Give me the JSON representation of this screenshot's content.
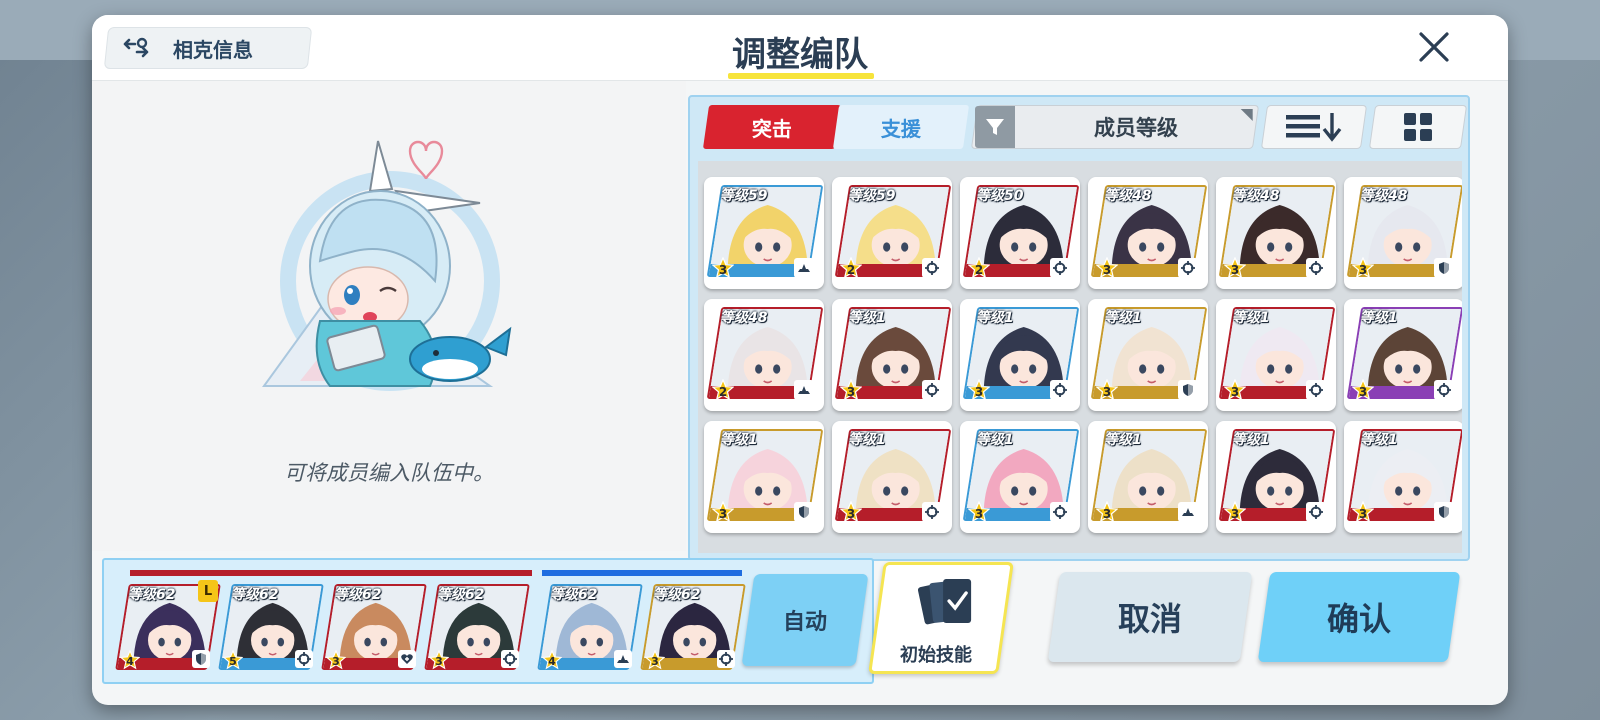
{
  "header": {
    "affinity_label": "相克信息",
    "title": "调整编队"
  },
  "empty_area": {
    "hint": "可将成员编入队伍中。"
  },
  "tabs": {
    "attack": "突击",
    "support": "支援"
  },
  "filter": {
    "label": "成员等级"
  },
  "roster": [
    {
      "level": "等级59",
      "star": "3",
      "role": "tank-icon",
      "frame": "#3a9ad6",
      "bg": "#f2d36a"
    },
    {
      "level": "等级59",
      "star": "2",
      "role": "target-icon",
      "frame": "#b51e2a",
      "bg": "#f5de8a"
    },
    {
      "level": "等级50",
      "star": "2",
      "role": "target-icon",
      "frame": "#b51e2a",
      "bg": "#2c2c3a"
    },
    {
      "level": "等级48",
      "star": "3",
      "role": "target-icon",
      "frame": "#c89b2c",
      "bg": "#3a3346"
    },
    {
      "level": "等级48",
      "star": "3",
      "role": "target-icon",
      "frame": "#c89b2c",
      "bg": "#3b2a2a"
    },
    {
      "level": "等级48",
      "star": "3",
      "role": "shield-icon",
      "frame": "#c89b2c",
      "bg": "#e6e8ef"
    },
    {
      "level": "等级48",
      "star": "2",
      "role": "tank-icon",
      "frame": "#b51e2a",
      "bg": "#e9e4e6"
    },
    {
      "level": "等级1",
      "star": "3",
      "role": "target-icon",
      "frame": "#b51e2a",
      "bg": "#6a4a3c"
    },
    {
      "level": "等级1",
      "star": "3",
      "role": "target-icon",
      "frame": "#3a9ad6",
      "bg": "#33394f"
    },
    {
      "level": "等级1",
      "star": "3",
      "role": "shield-icon",
      "frame": "#c89b2c",
      "bg": "#f1e3d2"
    },
    {
      "level": "等级1",
      "star": "3",
      "role": "target-icon",
      "frame": "#b51e2a",
      "bg": "#efe9f2"
    },
    {
      "level": "等级1",
      "star": "3",
      "role": "target-icon",
      "frame": "#8a3fb5",
      "bg": "#5c4437"
    },
    {
      "level": "等级1",
      "star": "3",
      "role": "shield-icon",
      "frame": "#c89b2c",
      "bg": "#f6d3dc"
    },
    {
      "level": "等级1",
      "star": "3",
      "role": "target-icon",
      "frame": "#b51e2a",
      "bg": "#efe1c4"
    },
    {
      "level": "等级1",
      "star": "3",
      "role": "target-icon",
      "frame": "#3a9ad6",
      "bg": "#f2a8c0"
    },
    {
      "level": "等级1",
      "star": "3",
      "role": "tank-icon",
      "frame": "#c89b2c",
      "bg": "#ede0c8"
    },
    {
      "level": "等级1",
      "star": "3",
      "role": "target-icon",
      "frame": "#b51e2a",
      "bg": "#2d2b3a"
    },
    {
      "level": "等级1",
      "star": "3",
      "role": "shield-icon",
      "frame": "#b51e2a",
      "bg": "#eceef3"
    }
  ],
  "team": {
    "slots": [
      {
        "level": "等级62",
        "star": "4",
        "role": "shield-icon",
        "leader": "L",
        "frame": "#b51e2a",
        "bg": "#3b2f5c"
      },
      {
        "level": "等级62",
        "star": "5",
        "role": "target-icon",
        "frame": "#3a9ad6",
        "bg": "#2e2f36"
      },
      {
        "level": "等级62",
        "star": "3",
        "role": "heal-icon",
        "frame": "#b51e2a",
        "bg": "#c98a5f"
      },
      {
        "level": "等级62",
        "star": "3",
        "role": "target-icon",
        "frame": "#b51e2a",
        "bg": "#2c3a3a"
      },
      {
        "level": "等级62",
        "star": "4",
        "role": "tank-icon",
        "frame": "#3a9ad6",
        "bg": "#9fb8d6"
      },
      {
        "level": "等级62",
        "star": "3",
        "role": "target-icon",
        "frame": "#c89b2c",
        "bg": "#2b2640"
      }
    ],
    "auto_label": "自动"
  },
  "skill": {
    "label": "初始技能"
  },
  "actions": {
    "cancel": "取消",
    "confirm": "确认"
  },
  "colors": {
    "strike": "#b51e2a",
    "special": "#1f6de0",
    "attack_tab": "#d9232f",
    "confirm": "#6fd0f8",
    "title_underline": "#f7e43b"
  }
}
